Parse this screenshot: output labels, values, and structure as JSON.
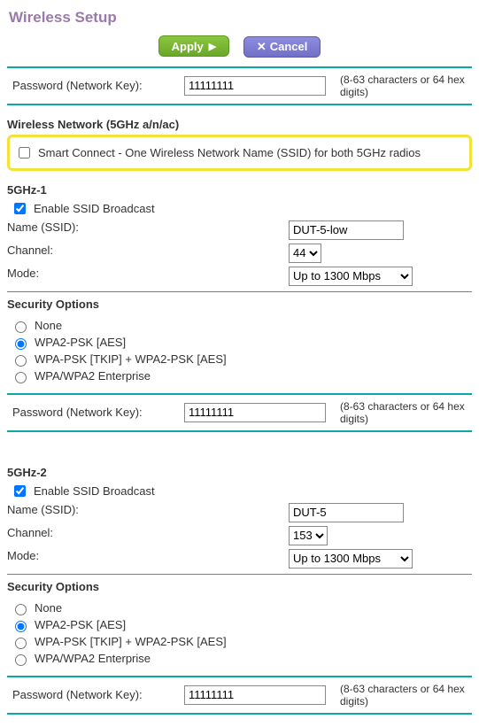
{
  "title": "Wireless Setup",
  "buttons": {
    "apply": "Apply",
    "cancel": "Cancel"
  },
  "top_password": {
    "label": "Password (Network Key):",
    "value": "11111111",
    "hint": "(8-63 characters or 64 hex digits)"
  },
  "network_section_title": "Wireless Network (5GHz a/n/ac)",
  "smart_connect": {
    "checked": false,
    "label": "Smart Connect - One Wireless Network Name (SSID) for both 5GHz radios"
  },
  "radios": [
    {
      "heading": "5GHz-1",
      "enable_broadcast": {
        "checked": true,
        "label": "Enable SSID Broadcast"
      },
      "ssid": {
        "label": "Name (SSID):",
        "value": "DUT-5-low"
      },
      "channel": {
        "label": "Channel:",
        "value": "44"
      },
      "mode": {
        "label": "Mode:",
        "value": "Up to 1300 Mbps"
      },
      "security_title": "Security Options",
      "security_options": [
        {
          "label": "None",
          "selected": false
        },
        {
          "label": "WPA2-PSK [AES]",
          "selected": true
        },
        {
          "label": "WPA-PSK [TKIP] + WPA2-PSK [AES]",
          "selected": false
        },
        {
          "label": "WPA/WPA2 Enterprise",
          "selected": false
        }
      ],
      "password": {
        "label": "Password (Network Key):",
        "value": "11111111",
        "hint": "(8-63 characters or 64 hex digits)"
      }
    },
    {
      "heading": "5GHz-2",
      "enable_broadcast": {
        "checked": true,
        "label": "Enable SSID Broadcast"
      },
      "ssid": {
        "label": "Name (SSID):",
        "value": "DUT-5"
      },
      "channel": {
        "label": "Channel:",
        "value": "153"
      },
      "mode": {
        "label": "Mode:",
        "value": "Up to 1300 Mbps"
      },
      "security_title": "Security Options",
      "security_options": [
        {
          "label": "None",
          "selected": false
        },
        {
          "label": "WPA2-PSK [AES]",
          "selected": true
        },
        {
          "label": "WPA-PSK [TKIP] + WPA2-PSK [AES]",
          "selected": false
        },
        {
          "label": "WPA/WPA2 Enterprise",
          "selected": false
        }
      ],
      "password": {
        "label": "Password (Network Key):",
        "value": "11111111",
        "hint": "(8-63 characters or 64 hex digits)"
      }
    }
  ]
}
